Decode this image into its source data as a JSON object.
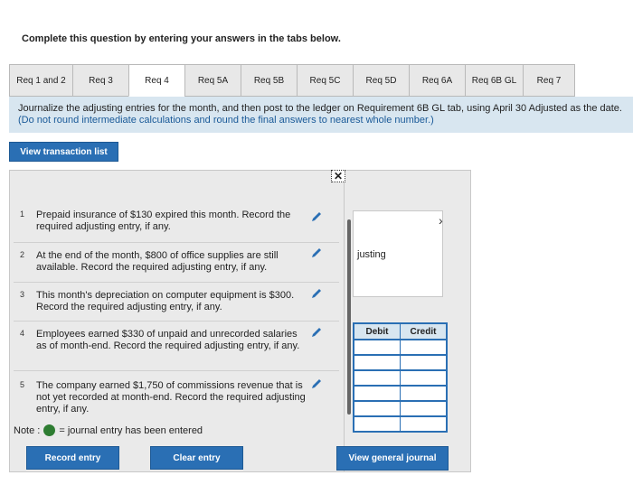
{
  "instruction": "Complete this question by entering your answers in the tabs below.",
  "tabs": [
    {
      "label": "Req 1 and 2",
      "active": false
    },
    {
      "label": "Req 3",
      "active": false
    },
    {
      "label": "Req 4",
      "active": true
    },
    {
      "label": "Req 5A",
      "active": false
    },
    {
      "label": "Req 5B",
      "active": false
    },
    {
      "label": "Req 5C",
      "active": false
    },
    {
      "label": "Req 5D",
      "active": false
    },
    {
      "label": "Req 6A",
      "active": false
    },
    {
      "label": "Req 6B GL",
      "active": false
    },
    {
      "label": "Req 7",
      "active": false
    }
  ],
  "panel": {
    "text": "Journalize the adjusting entries for the month, and then post to the ledger on Requirement 6B GL tab, using April 30 Adjusted as the date.",
    "paren": "(Do not round intermediate calculations and round the final answers to nearest whole number.)"
  },
  "view_transaction_list": "View transaction list",
  "transactions": [
    {
      "num": "1",
      "text": "Prepaid insurance of $130 expired this month. Record the required adjusting entry, if any."
    },
    {
      "num": "2",
      "text": "At the end of the month, $800 of office supplies are still available. Record the required adjusting entry, if any."
    },
    {
      "num": "3",
      "text": "This month's depreciation on computer equipment is $300. Record the required adjusting entry, if any."
    },
    {
      "num": "4",
      "text": "Employees earned $330 of unpaid and unrecorded salaries as of month-end. Record the required adjusting entry, if any."
    },
    {
      "num": "5",
      "text": "The company earned $1,750 of commissions revenue that is not yet recorded at month-end. Record the required adjusting entry, if any."
    }
  ],
  "close_glyph": "✕",
  "right_fragment": "justing",
  "chevron": "›",
  "journal": {
    "debit": "Debit",
    "credit": "Credit"
  },
  "note": {
    "prefix": "Note :",
    "suffix": "= journal entry has been entered"
  },
  "buttons": {
    "record": "Record entry",
    "clear": "Clear entry",
    "view_gl": "View general journal"
  },
  "colors": {
    "accent": "#2a6fb4",
    "panel": "#d8e6f0",
    "dot": "#2e7d32"
  }
}
